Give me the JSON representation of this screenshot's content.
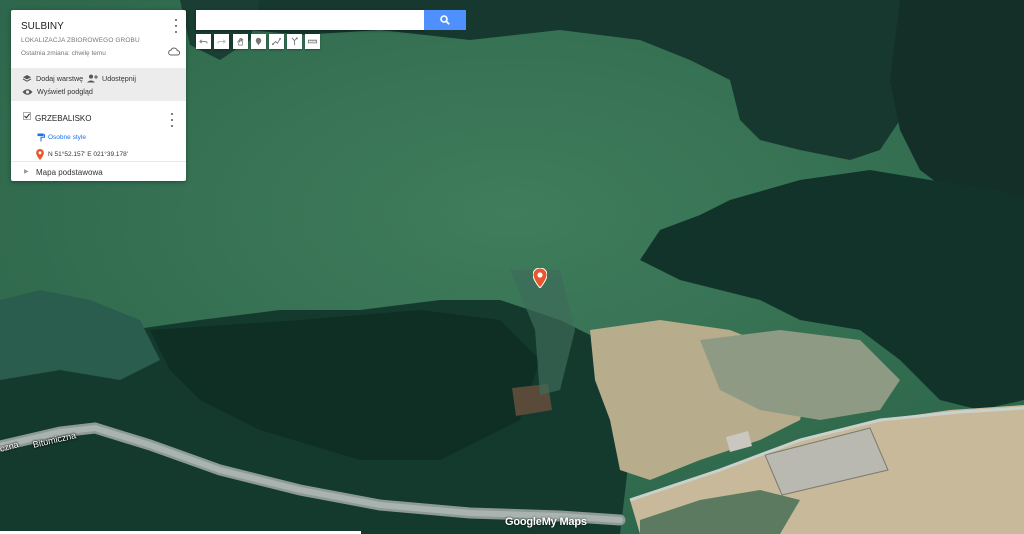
{
  "map": {
    "title": "SULBINY",
    "description": "LOKALIZACJA ZBIOROWEGO GROBU",
    "last_change": "Ostatnia zmiana: chwilę temu",
    "actions": {
      "add_layer": "Dodaj warstwę",
      "share": "Udostępnij",
      "preview": "Wyświetl podgląd"
    },
    "layer": {
      "name": "GRZEBALISKO",
      "style_link": "Osobne style",
      "place": "N 51°52.157' E 021°39.178'"
    },
    "base_map": "Mapa podstawowa"
  },
  "search": {
    "value": "",
    "placeholder": ""
  },
  "toolbar": [
    "undo-icon",
    "redo-icon",
    "hand-icon",
    "add-marker-icon",
    "draw-line-icon",
    "directions-icon",
    "measure-icon"
  ],
  "roads": {
    "left_label": "czna",
    "main_label": "Bitumiczna"
  },
  "logo": {
    "google": "Google",
    "mymaps": "My Maps"
  },
  "colors": {
    "accent": "#4d90fe",
    "marker": "#e8572b",
    "link": "#1a73e8"
  }
}
